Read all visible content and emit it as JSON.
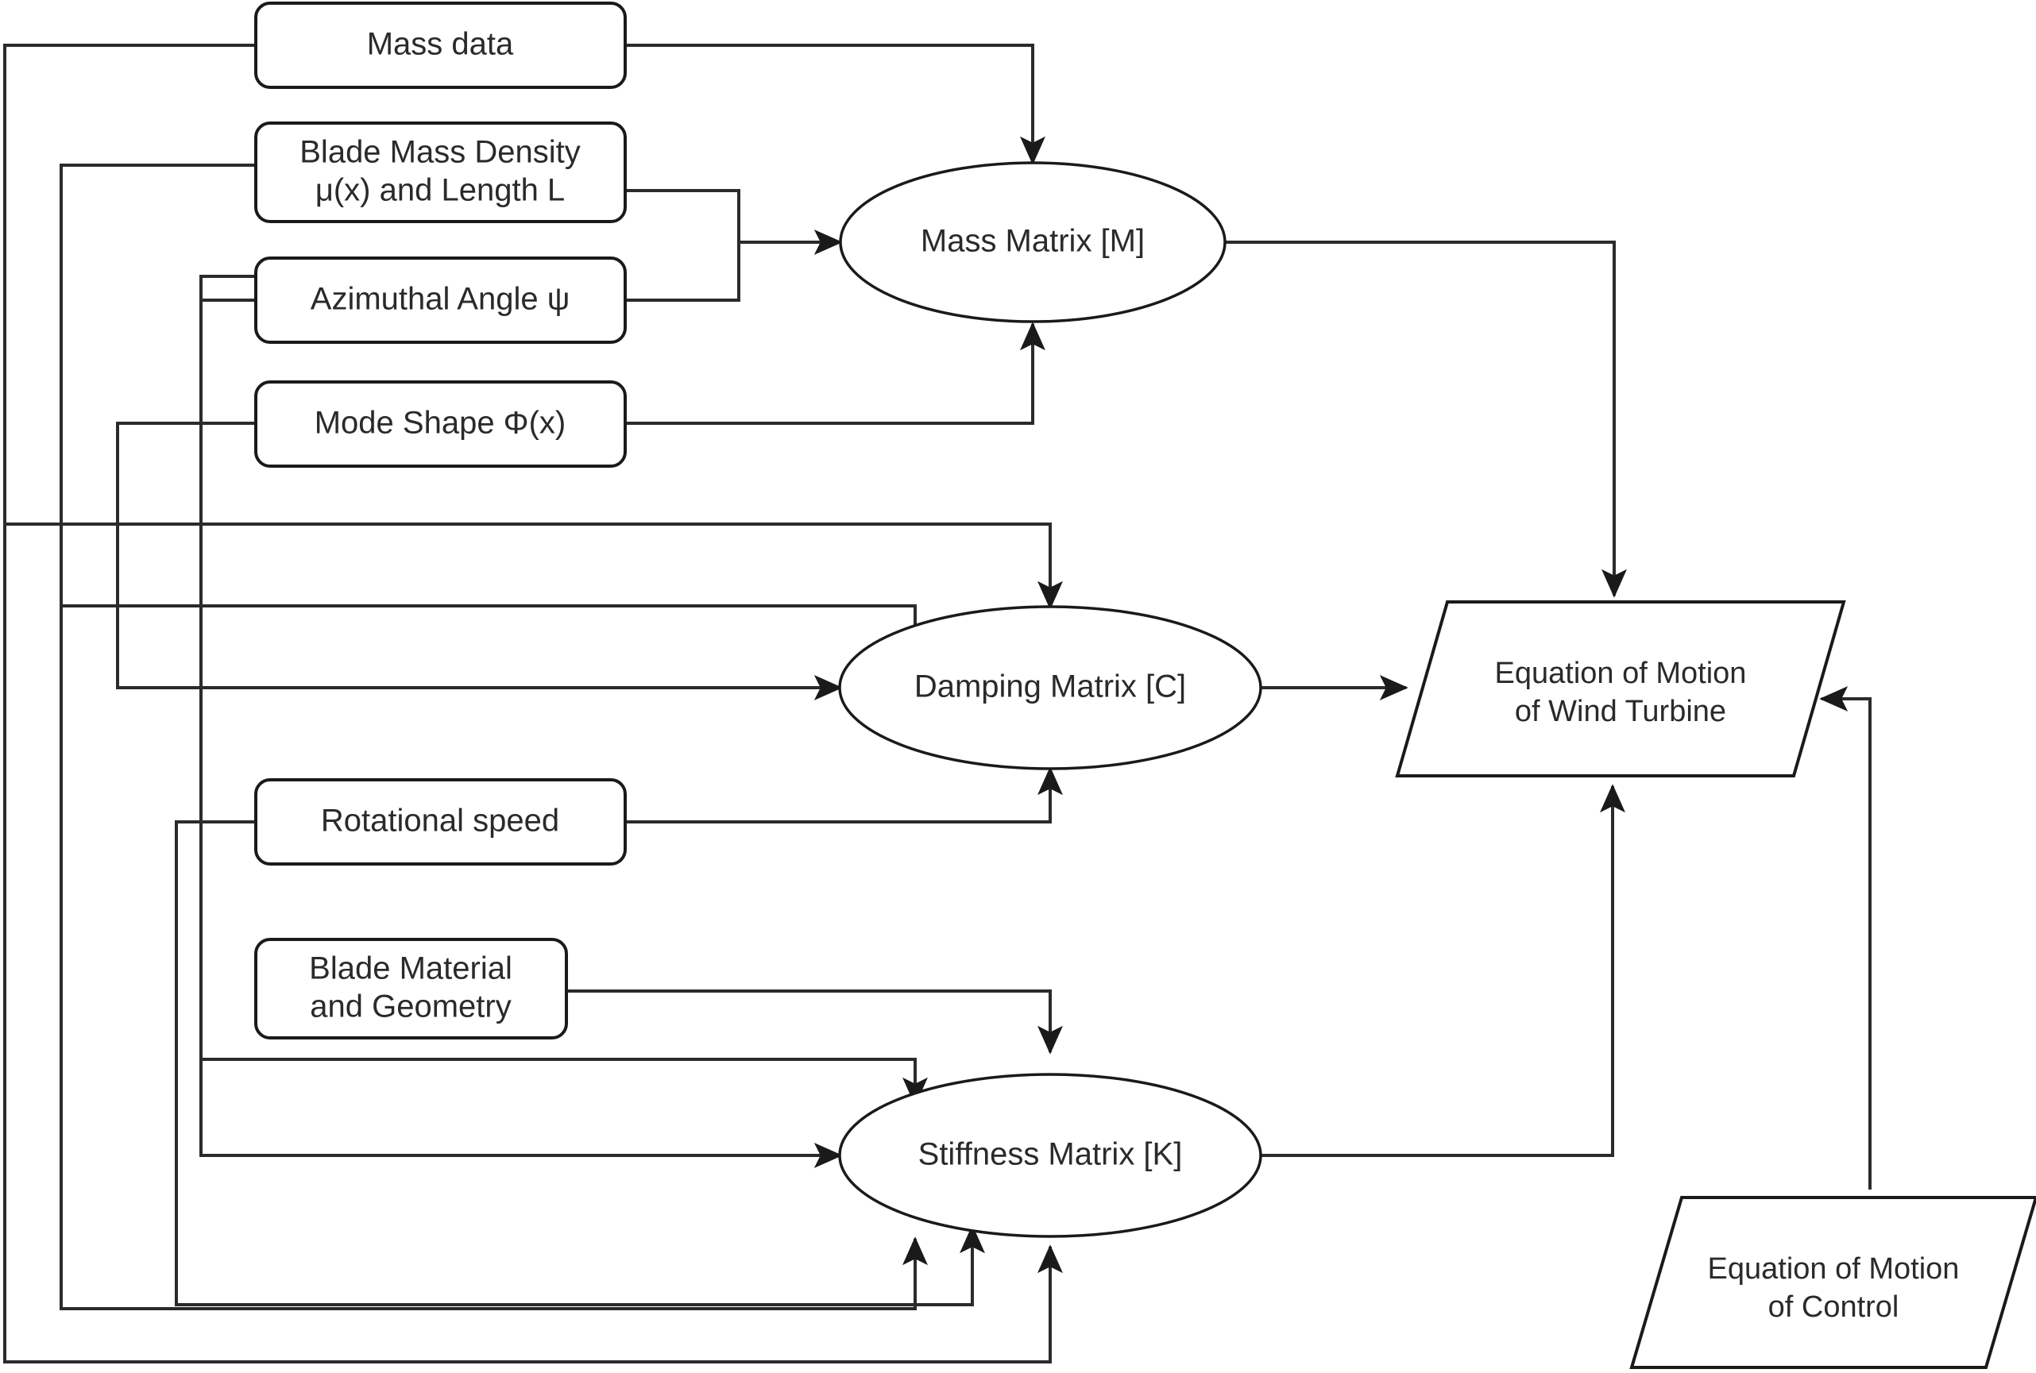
{
  "diagram": {
    "title": "Wind turbine blade equation of motion flowchart",
    "stroke_color": "#1a1a1a",
    "edge_color": "#2b2b2b",
    "background_color": "#ffffff",
    "nodes": {
      "mass_data": {
        "label": "Mass data",
        "shape": "rounded-rectangle"
      },
      "blade_mass_density": {
        "label_line1": "Blade Mass Density",
        "label_line2": "μ(x) and Length L",
        "shape": "rounded-rectangle"
      },
      "azimuthal_angle": {
        "label": "Azimuthal Angle ψ",
        "shape": "rounded-rectangle"
      },
      "mode_shape": {
        "label": "Mode Shape Φ(x)",
        "shape": "rounded-rectangle"
      },
      "rotational_speed": {
        "label": "Rotational speed",
        "shape": "rounded-rectangle"
      },
      "blade_material": {
        "label_line1": "Blade Material",
        "label_line2": "and Geometry",
        "shape": "rounded-rectangle"
      },
      "mass_matrix": {
        "label": "Mass Matrix [M]",
        "shape": "ellipse"
      },
      "damping_matrix": {
        "label": "Damping Matrix [C]",
        "shape": "ellipse"
      },
      "stiffness_matrix": {
        "label": "Stiffness Matrix [K]",
        "shape": "ellipse"
      },
      "eom_wind_turbine": {
        "label_line1": "Equation of Motion",
        "label_line2": "of Wind Turbine",
        "shape": "parallelogram"
      },
      "eom_control": {
        "label_line1": "Equation of Motion",
        "label_line2": "of Control",
        "shape": "parallelogram"
      }
    },
    "edges": [
      {
        "from": "mass_data",
        "to": "mass_matrix",
        "arrow": "top"
      },
      {
        "from": "blade_mass_density",
        "to": "mass_matrix",
        "arrow": "left"
      },
      {
        "from": "azimuthal_angle",
        "to": "mass_matrix",
        "arrow": "left"
      },
      {
        "from": "mode_shape",
        "to": "mass_matrix",
        "arrow": "bottom"
      },
      {
        "from": "mass_data",
        "to": "damping_matrix",
        "arrow": "top"
      },
      {
        "from": "blade_mass_density",
        "to": "damping_matrix",
        "arrow": "top"
      },
      {
        "from": "mode_shape",
        "to": "damping_matrix",
        "arrow": "left"
      },
      {
        "from": "rotational_speed",
        "to": "damping_matrix",
        "arrow": "bottom"
      },
      {
        "from": "blade_material",
        "to": "stiffness_matrix",
        "arrow": "top"
      },
      {
        "from": "azimuthal_angle",
        "to": "stiffness_matrix",
        "arrow": "top"
      },
      {
        "from": "mode_shape",
        "to": "stiffness_matrix",
        "arrow": "left"
      },
      {
        "from": "rotational_speed",
        "to": "stiffness_matrix",
        "arrow": "bottom"
      },
      {
        "from": "blade_mass_density",
        "to": "stiffness_matrix",
        "arrow": "bottom"
      },
      {
        "from": "mass_data",
        "to": "stiffness_matrix",
        "arrow": "bottom"
      },
      {
        "from": "mass_matrix",
        "to": "eom_wind_turbine",
        "arrow": "top"
      },
      {
        "from": "damping_matrix",
        "to": "eom_wind_turbine",
        "arrow": "left"
      },
      {
        "from": "stiffness_matrix",
        "to": "eom_wind_turbine",
        "arrow": "bottom"
      },
      {
        "from": "eom_control",
        "to": "eom_wind_turbine",
        "arrow": "right"
      }
    ]
  }
}
